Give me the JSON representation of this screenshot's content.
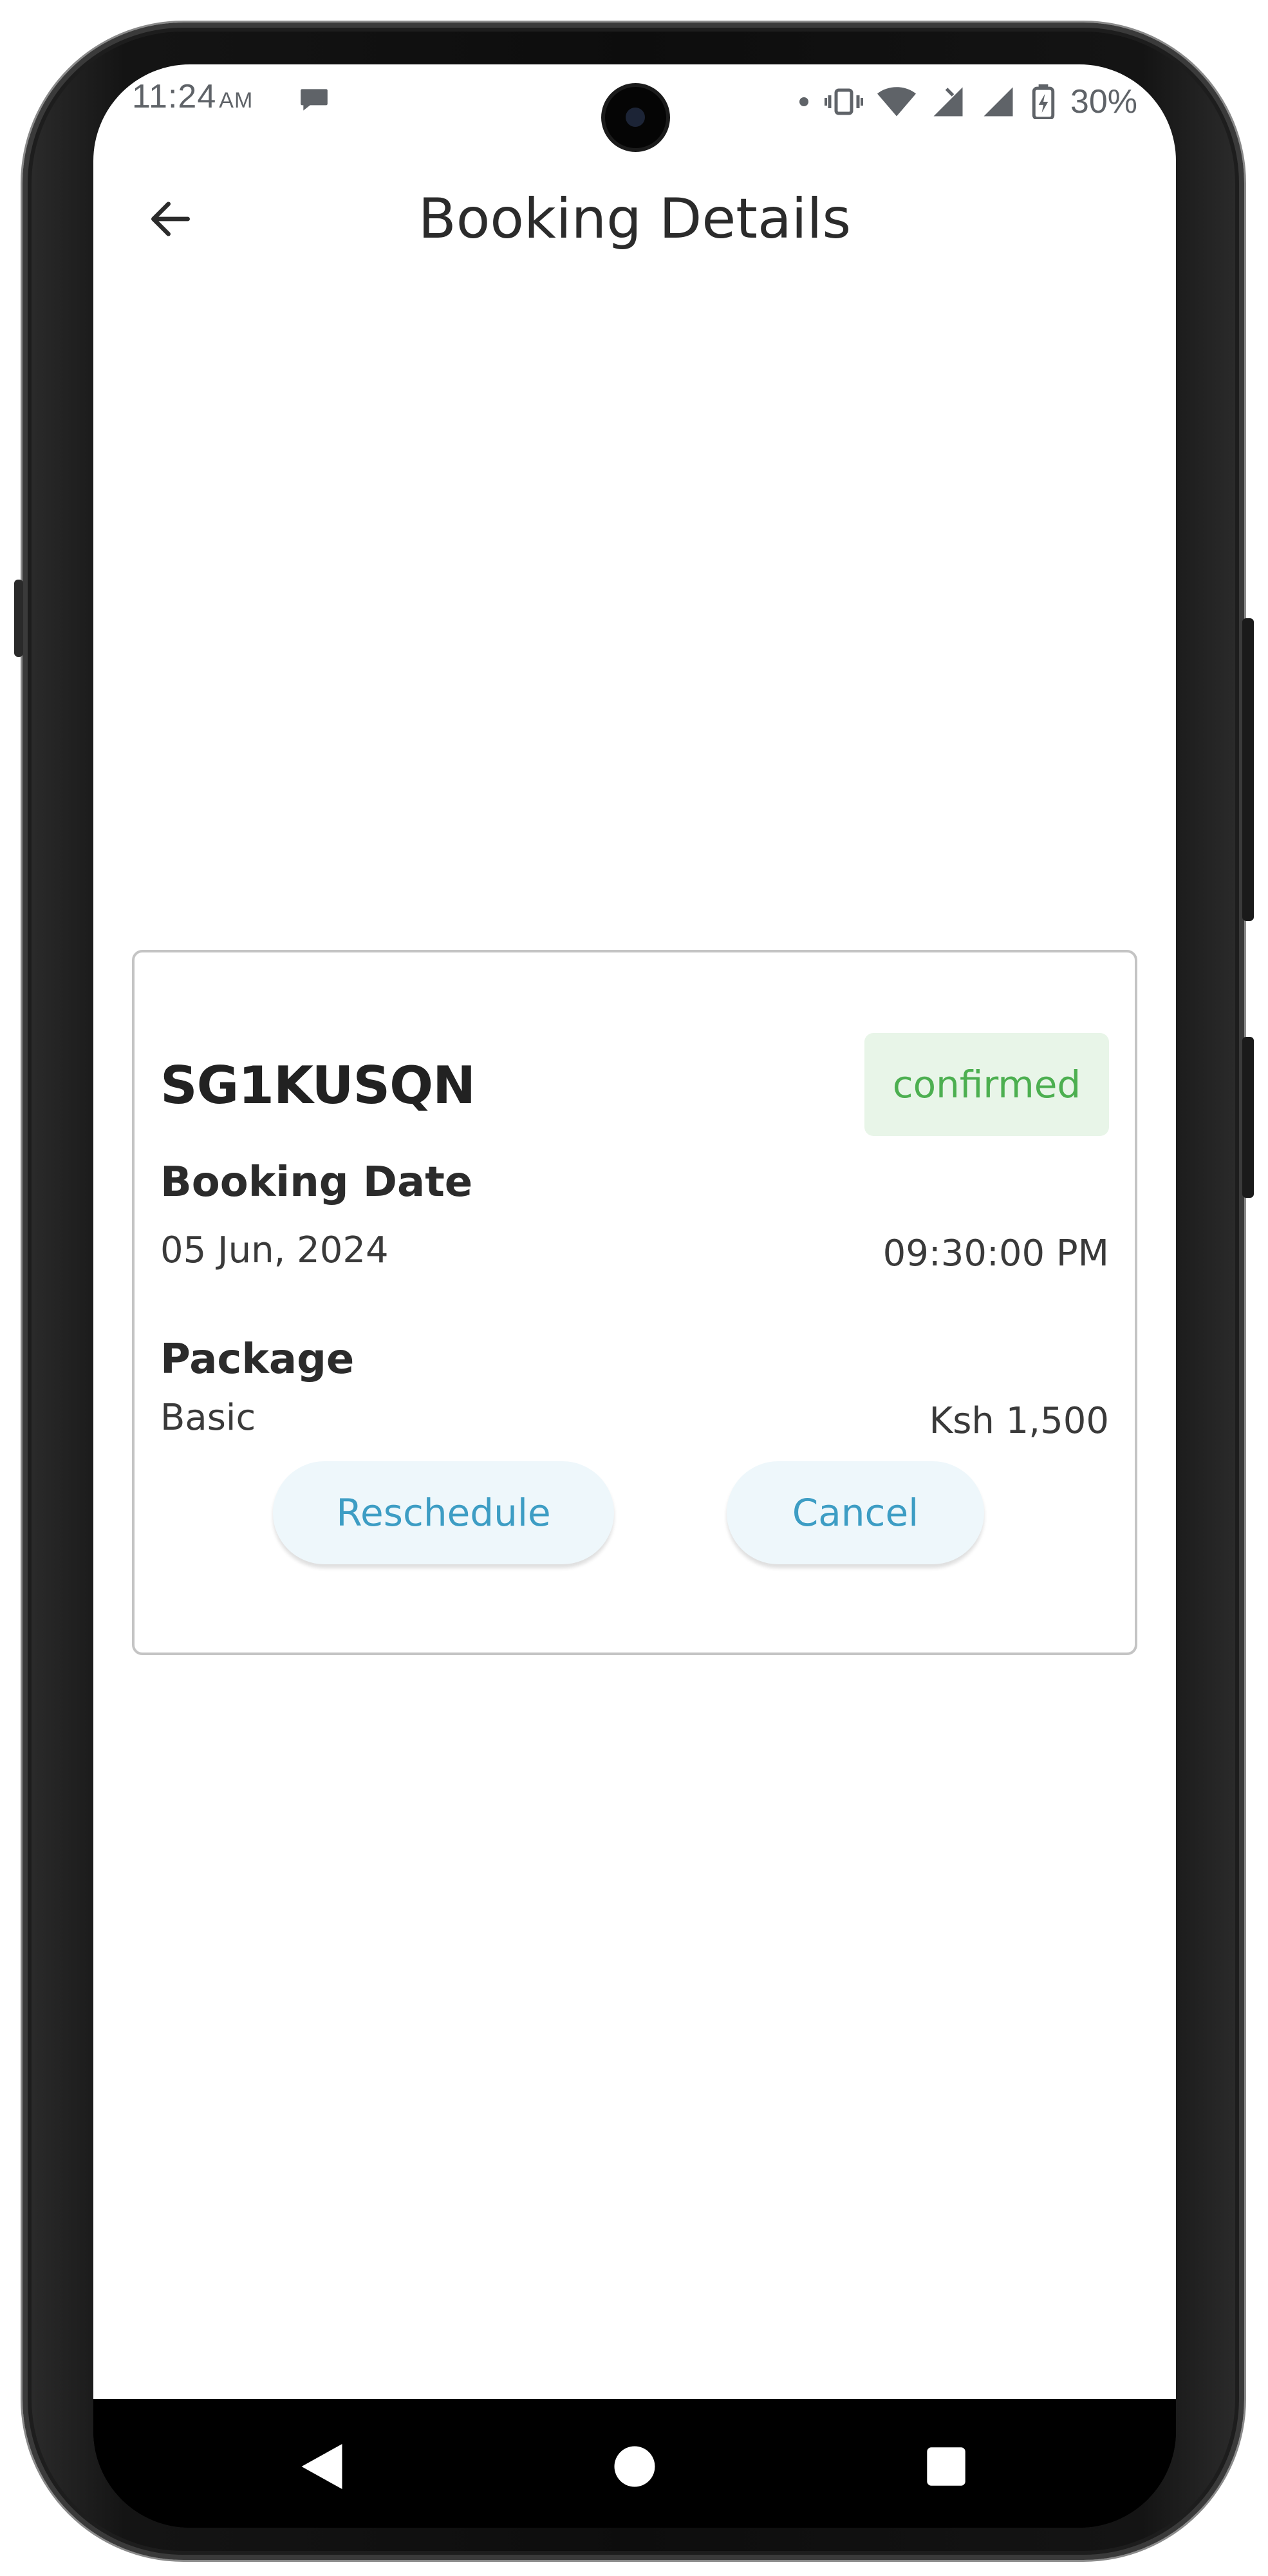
{
  "status_bar": {
    "time": "11:24",
    "ampm": "AM",
    "battery": "30%"
  },
  "header": {
    "title": "Booking Details",
    "back_icon": "arrow-left-icon"
  },
  "booking": {
    "code": "SG1KUSQN",
    "status": "confirmed",
    "date_label": "Booking Date",
    "date": "05 Jun, 2024",
    "time": "09:30:00 PM",
    "package_label": "Package",
    "package": "Basic",
    "price": "Ksh 1,500",
    "actions": {
      "reschedule": "Reschedule",
      "cancel": "Cancel"
    }
  },
  "nav": {
    "back_icon": "triangle-back-icon",
    "home_icon": "circle-home-icon",
    "recents_icon": "square-recents-icon"
  },
  "colors": {
    "status_text": "#4caf50",
    "status_bg": "#e8f5e8",
    "action_text": "#3d9dc4",
    "action_bg": "#eef7fb"
  }
}
